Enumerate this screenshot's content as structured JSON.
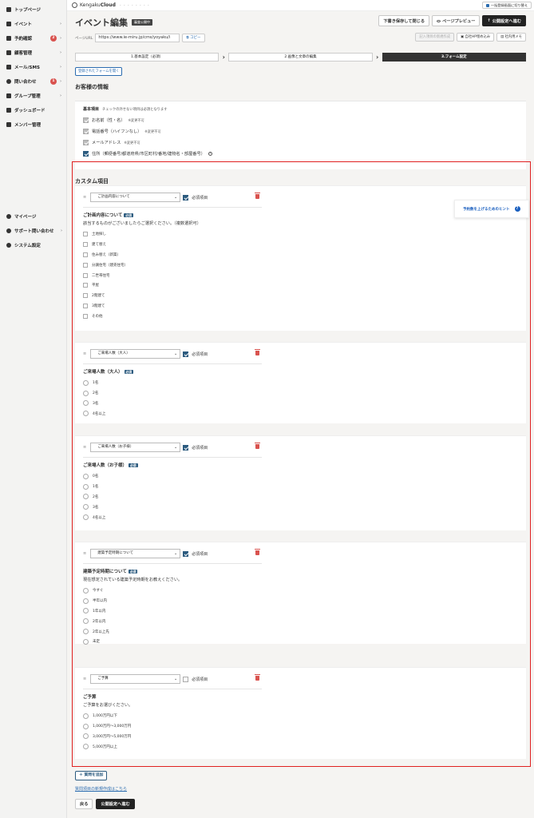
{
  "sidebar": {
    "items": [
      {
        "label": "トップページ",
        "badge": "",
        "chevron": false
      },
      {
        "label": "イベント",
        "badge": "",
        "chevron": true
      },
      {
        "label": "予約確認",
        "badge": "2",
        "chevron": true
      },
      {
        "label": "顧客管理",
        "badge": "",
        "chevron": true
      },
      {
        "label": "メール/SMS",
        "badge": "",
        "chevron": true
      },
      {
        "label": "問い合わせ",
        "badge": "1",
        "chevron": true
      },
      {
        "label": "グループ管理",
        "badge": "",
        "chevron": true
      },
      {
        "label": "ダッシュボード",
        "badge": "",
        "chevron": false
      },
      {
        "label": "メンバー管理",
        "badge": "",
        "chevron": false
      }
    ],
    "bottom_items": [
      {
        "label": "マイページ",
        "chevron": false
      },
      {
        "label": "サポート問い合わせ",
        "chevron": true
      },
      {
        "label": "システム設定",
        "chevron": false
      }
    ]
  },
  "topbar": {
    "brand_light": "Kengaku",
    "brand_bold": "Cloud",
    "brand_dots": "・・・・・・・・",
    "right_button": "一括登録画面に切り替え"
  },
  "header": {
    "title": "イベント編集",
    "status_tag": "審査公開中",
    "save_draft": "下書き保存して閉じる",
    "preview": "ページプレビュー",
    "publish": "公開設定へ進む"
  },
  "url_row": {
    "label": "ページURL",
    "value": "https://www.ie-miru.jp/cms/yoyaku/i",
    "copy": "コピー",
    "actions": [
      "記入項目の新規作成",
      "自社HP埋め込み",
      "社内用メモ"
    ]
  },
  "steps": [
    "1.基本設定（必須）",
    "2.画像と文章の編集",
    "3.フォーム設定"
  ],
  "open_form_button": "登録されたフォームを開く",
  "customer_section": {
    "title": "お客様の情報",
    "basic_label": "基本項目",
    "basic_note": "チェックの外せない項目は必須となります",
    "rows": [
      {
        "label": "お名前（性・名）",
        "note": "※変更不可",
        "checked": "gray"
      },
      {
        "label": "電話番号（ハイフンなし）",
        "note": "※変更不可",
        "checked": "gray"
      },
      {
        "label": "メールアドレス",
        "note": "※変更不可",
        "checked": "gray"
      },
      {
        "label": "住所（郵便番号/都道府県/市区町村/番地/建物名・部屋番号）",
        "note": "",
        "checked": "blue"
      }
    ]
  },
  "custom_section": {
    "title": "カスタム項目",
    "hint": "予約数を上げるためのヒント",
    "hint_icon": "?",
    "required_label": "必須項目",
    "required_tag": "必須",
    "questions": [
      {
        "select": "ご計画内容について",
        "required": true,
        "title": "ご計画内容について",
        "desc": "該当するものがございましたらご選択ください。（複数選択可）",
        "input": "checkbox",
        "options": [
          "土地探し",
          "建て替え",
          "住み替え（新築）",
          "分譲住宅（建売住宅）",
          "二世帯住宅",
          "平屋",
          "2階建て",
          "3階建て",
          "その他"
        ]
      },
      {
        "select": "ご来場人数（大人）",
        "required": true,
        "title": "ご来場人数（大人）",
        "desc": "",
        "input": "radio",
        "options": [
          "1名",
          "2名",
          "3名",
          "4名以上"
        ]
      },
      {
        "select": "ご来場人数（お子様）",
        "required": true,
        "title": "ご来場人数（お子様）",
        "desc": "",
        "input": "radio",
        "options": [
          "0名",
          "1名",
          "2名",
          "3名",
          "4名以上"
        ]
      },
      {
        "select": "建築予定時期について",
        "required": true,
        "title": "建築予定時期について",
        "desc": "現在想定されている建築予定時期をお教えください。",
        "input": "radio",
        "options": [
          "今すぐ",
          "半年以内",
          "1年以内",
          "2年以内",
          "2年以上先",
          "未定"
        ]
      },
      {
        "select": "ご予算",
        "required": false,
        "title": "ご予算",
        "desc": "ご予算をお選びください。",
        "input": "radio",
        "options": [
          "1,000万円以下",
          "1,000万円〜3,000万円",
          "3,000万円〜5,000万円",
          "5,000万円以上"
        ]
      }
    ]
  },
  "footer": {
    "add_question": "＋ 質問を追加",
    "new_item_link": "質問項目の新規作成はこちら",
    "back": "戻る",
    "publish": "公開設定へ進む"
  },
  "colors": {
    "accent": "#2c5b7f",
    "danger": "#d9534f",
    "frame": "#e02020",
    "link": "#2b6cb0"
  }
}
